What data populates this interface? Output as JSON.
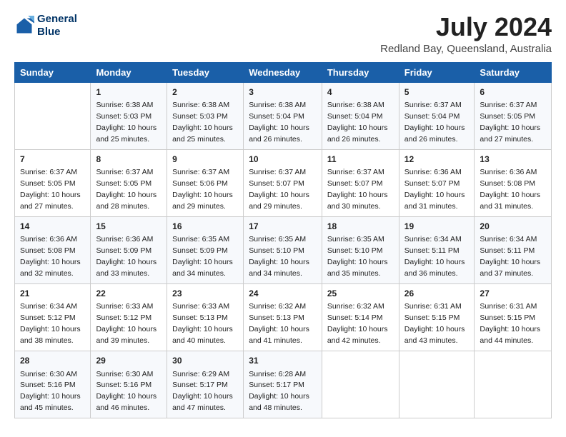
{
  "logo": {
    "line1": "General",
    "line2": "Blue"
  },
  "title": "July 2024",
  "location": "Redland Bay, Queensland, Australia",
  "days_of_week": [
    "Sunday",
    "Monday",
    "Tuesday",
    "Wednesday",
    "Thursday",
    "Friday",
    "Saturday"
  ],
  "weeks": [
    [
      {
        "day": "",
        "info": ""
      },
      {
        "day": "1",
        "info": "Sunrise: 6:38 AM\nSunset: 5:03 PM\nDaylight: 10 hours\nand 25 minutes."
      },
      {
        "day": "2",
        "info": "Sunrise: 6:38 AM\nSunset: 5:03 PM\nDaylight: 10 hours\nand 25 minutes."
      },
      {
        "day": "3",
        "info": "Sunrise: 6:38 AM\nSunset: 5:04 PM\nDaylight: 10 hours\nand 26 minutes."
      },
      {
        "day": "4",
        "info": "Sunrise: 6:38 AM\nSunset: 5:04 PM\nDaylight: 10 hours\nand 26 minutes."
      },
      {
        "day": "5",
        "info": "Sunrise: 6:37 AM\nSunset: 5:04 PM\nDaylight: 10 hours\nand 26 minutes."
      },
      {
        "day": "6",
        "info": "Sunrise: 6:37 AM\nSunset: 5:05 PM\nDaylight: 10 hours\nand 27 minutes."
      }
    ],
    [
      {
        "day": "7",
        "info": "Sunrise: 6:37 AM\nSunset: 5:05 PM\nDaylight: 10 hours\nand 27 minutes."
      },
      {
        "day": "8",
        "info": "Sunrise: 6:37 AM\nSunset: 5:05 PM\nDaylight: 10 hours\nand 28 minutes."
      },
      {
        "day": "9",
        "info": "Sunrise: 6:37 AM\nSunset: 5:06 PM\nDaylight: 10 hours\nand 29 minutes."
      },
      {
        "day": "10",
        "info": "Sunrise: 6:37 AM\nSunset: 5:07 PM\nDaylight: 10 hours\nand 29 minutes."
      },
      {
        "day": "11",
        "info": "Sunrise: 6:37 AM\nSunset: 5:07 PM\nDaylight: 10 hours\nand 30 minutes."
      },
      {
        "day": "12",
        "info": "Sunrise: 6:36 AM\nSunset: 5:07 PM\nDaylight: 10 hours\nand 31 minutes."
      },
      {
        "day": "13",
        "info": "Sunrise: 6:36 AM\nSunset: 5:08 PM\nDaylight: 10 hours\nand 31 minutes."
      }
    ],
    [
      {
        "day": "14",
        "info": "Sunrise: 6:36 AM\nSunset: 5:08 PM\nDaylight: 10 hours\nand 32 minutes."
      },
      {
        "day": "15",
        "info": "Sunrise: 6:36 AM\nSunset: 5:09 PM\nDaylight: 10 hours\nand 33 minutes."
      },
      {
        "day": "16",
        "info": "Sunrise: 6:35 AM\nSunset: 5:09 PM\nDaylight: 10 hours\nand 34 minutes."
      },
      {
        "day": "17",
        "info": "Sunrise: 6:35 AM\nSunset: 5:10 PM\nDaylight: 10 hours\nand 34 minutes."
      },
      {
        "day": "18",
        "info": "Sunrise: 6:35 AM\nSunset: 5:10 PM\nDaylight: 10 hours\nand 35 minutes."
      },
      {
        "day": "19",
        "info": "Sunrise: 6:34 AM\nSunset: 5:11 PM\nDaylight: 10 hours\nand 36 minutes."
      },
      {
        "day": "20",
        "info": "Sunrise: 6:34 AM\nSunset: 5:11 PM\nDaylight: 10 hours\nand 37 minutes."
      }
    ],
    [
      {
        "day": "21",
        "info": "Sunrise: 6:34 AM\nSunset: 5:12 PM\nDaylight: 10 hours\nand 38 minutes."
      },
      {
        "day": "22",
        "info": "Sunrise: 6:33 AM\nSunset: 5:12 PM\nDaylight: 10 hours\nand 39 minutes."
      },
      {
        "day": "23",
        "info": "Sunrise: 6:33 AM\nSunset: 5:13 PM\nDaylight: 10 hours\nand 40 minutes."
      },
      {
        "day": "24",
        "info": "Sunrise: 6:32 AM\nSunset: 5:13 PM\nDaylight: 10 hours\nand 41 minutes."
      },
      {
        "day": "25",
        "info": "Sunrise: 6:32 AM\nSunset: 5:14 PM\nDaylight: 10 hours\nand 42 minutes."
      },
      {
        "day": "26",
        "info": "Sunrise: 6:31 AM\nSunset: 5:15 PM\nDaylight: 10 hours\nand 43 minutes."
      },
      {
        "day": "27",
        "info": "Sunrise: 6:31 AM\nSunset: 5:15 PM\nDaylight: 10 hours\nand 44 minutes."
      }
    ],
    [
      {
        "day": "28",
        "info": "Sunrise: 6:30 AM\nSunset: 5:16 PM\nDaylight: 10 hours\nand 45 minutes."
      },
      {
        "day": "29",
        "info": "Sunrise: 6:30 AM\nSunset: 5:16 PM\nDaylight: 10 hours\nand 46 minutes."
      },
      {
        "day": "30",
        "info": "Sunrise: 6:29 AM\nSunset: 5:17 PM\nDaylight: 10 hours\nand 47 minutes."
      },
      {
        "day": "31",
        "info": "Sunrise: 6:28 AM\nSunset: 5:17 PM\nDaylight: 10 hours\nand 48 minutes."
      },
      {
        "day": "",
        "info": ""
      },
      {
        "day": "",
        "info": ""
      },
      {
        "day": "",
        "info": ""
      }
    ]
  ]
}
